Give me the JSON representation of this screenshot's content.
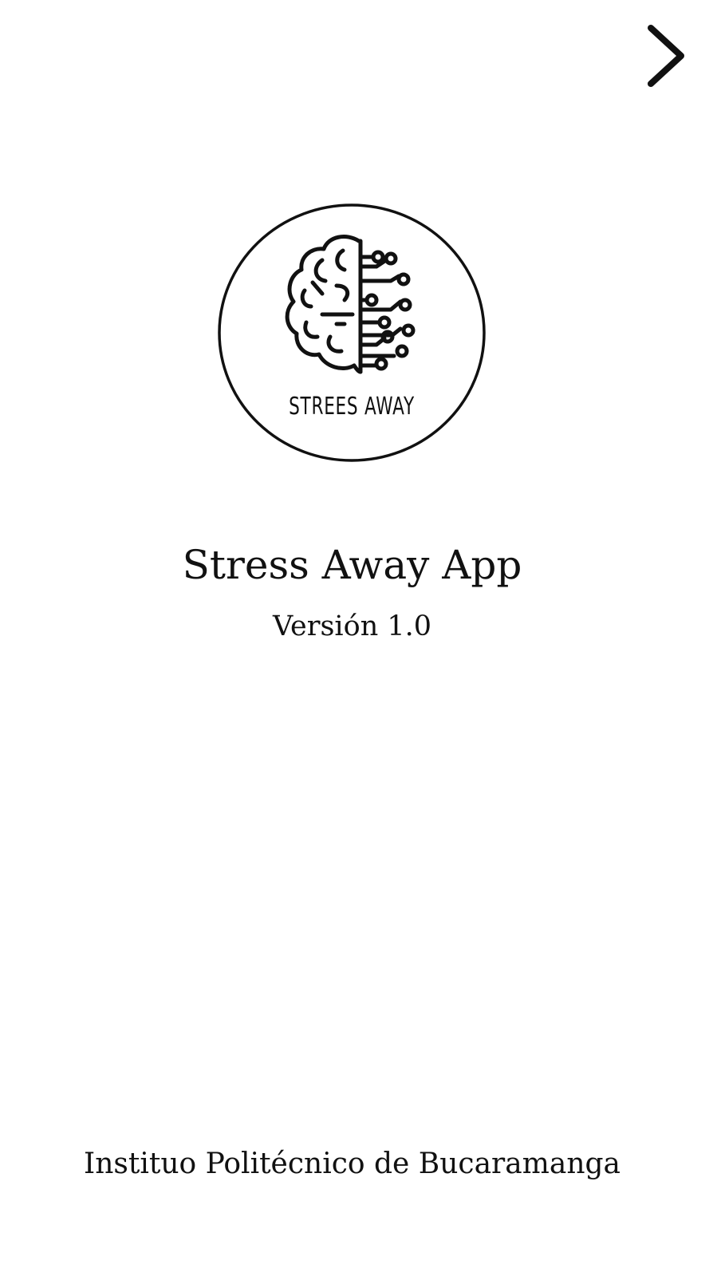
{
  "header": {
    "next_icon": "chevron-right-icon"
  },
  "logo": {
    "icon": "brain-circuit-icon",
    "text": "STREES AWAY"
  },
  "app": {
    "title": "Stress Away App",
    "version": "Versión 1.0"
  },
  "footer": {
    "institution": "Instituo Politécnico de Bucaramanga"
  }
}
